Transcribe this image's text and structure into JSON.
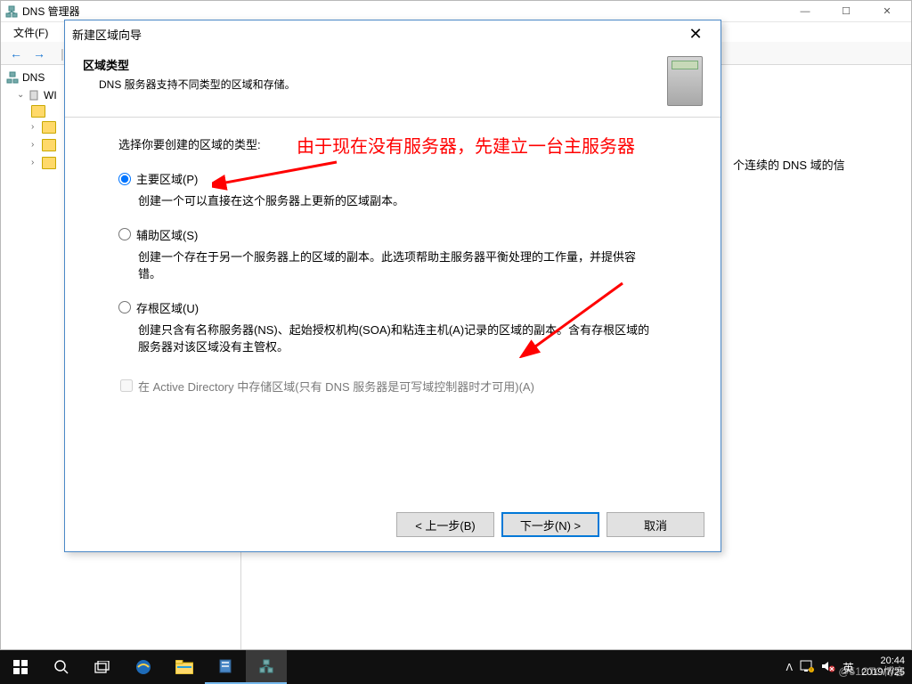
{
  "mainWindow": {
    "title": "DNS 管理器",
    "menus": {
      "file": "文件(F)"
    },
    "toolbar": {
      "back": "←",
      "fwd": "→",
      "pipe": "|"
    },
    "tree": {
      "root": "DNS",
      "server": "WI",
      "folders": [
        "",
        "",
        "",
        ""
      ]
    },
    "detail": {
      "fragment": "个连续的 DNS 域的信"
    },
    "winButtons": {
      "min": "—",
      "max": "☐",
      "close": "✕"
    }
  },
  "dialog": {
    "title": "新建区域向导",
    "header": {
      "heading": "区域类型",
      "sub": "DNS 服务器支持不同类型的区域和存储。"
    },
    "bodyLabel": "选择你要创建的区域的类型:",
    "annotation": "由于现在没有服务器，先建立一台主服务器",
    "options": {
      "primary": {
        "label": "主要区域(P)",
        "desc": "创建一个可以直接在这个服务器上更新的区域副本。"
      },
      "secondary": {
        "label": "辅助区域(S)",
        "desc": "创建一个存在于另一个服务器上的区域的副本。此选项帮助主服务器平衡处理的工作量，并提供容错。"
      },
      "stub": {
        "label": "存根区域(U)",
        "desc": "创建只含有名称服务器(NS)、起始授权机构(SOA)和粘连主机(A)记录的区域的副本。含有存根区域的服务器对该区域没有主管权。"
      }
    },
    "checkbox": {
      "label": "在 Active Directory 中存储区域(只有 DNS 服务器是可写域控制器时才可用)(A)"
    },
    "buttons": {
      "back": "< 上一步(B)",
      "next": "下一步(N) >",
      "cancel": "取消"
    }
  },
  "taskbar": {
    "ime": "英",
    "time": "20:44",
    "date": "2019/7/25",
    "watermark": "@51CTO博客"
  }
}
